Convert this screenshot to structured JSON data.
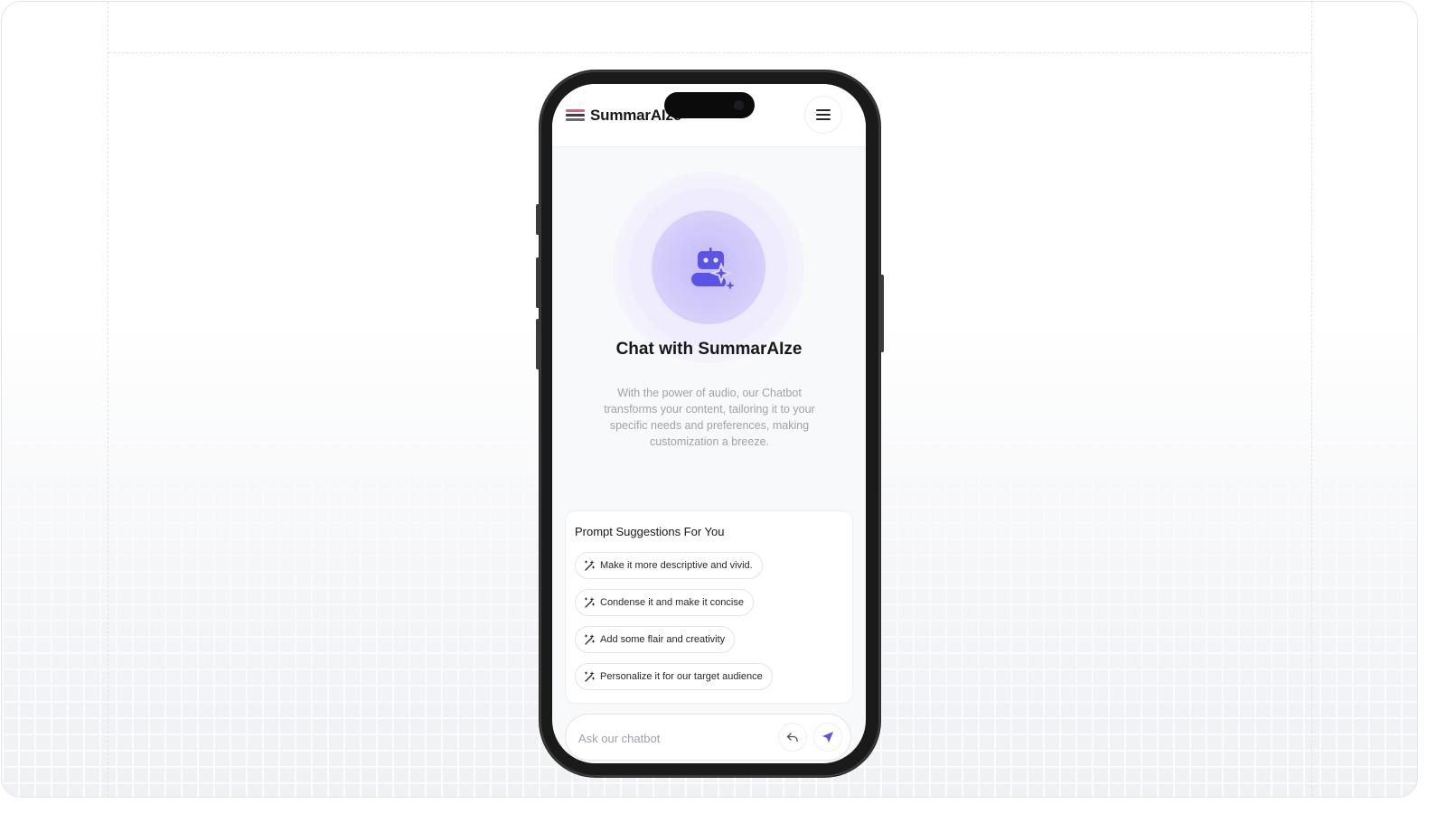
{
  "app": {
    "name": "SummarAIze",
    "logo_colors": {
      "top": "#d9647a",
      "middle": "#3f3f46",
      "bottom": "#6b6b73"
    }
  },
  "header": {
    "menu_icon": "hamburger-menu-icon"
  },
  "hero": {
    "icon": "robot-sparkle-icon",
    "title": "Chat with SummarAIze",
    "description": "With the power of audio, our Chatbot transforms your content, tailoring it to your specific needs and preferences, making customization a breeze."
  },
  "suggestions": {
    "title": "Prompt Suggestions For You",
    "chip_icon": "magic-wand-icon",
    "items": [
      {
        "label": "Make it more descriptive and vivid."
      },
      {
        "label": "Condense it and make it concise"
      },
      {
        "label": "Add some flair and creativity"
      },
      {
        "label": "Personalize it for our target audience"
      }
    ]
  },
  "composer": {
    "placeholder": "Ask our chatbot",
    "value": "",
    "undo_icon": "undo-arrow-icon",
    "send_icon": "send-paper-plane-icon"
  },
  "colors": {
    "accent": "#5b52e6",
    "text_primary": "#18181b",
    "text_muted": "#a1a1aa"
  }
}
